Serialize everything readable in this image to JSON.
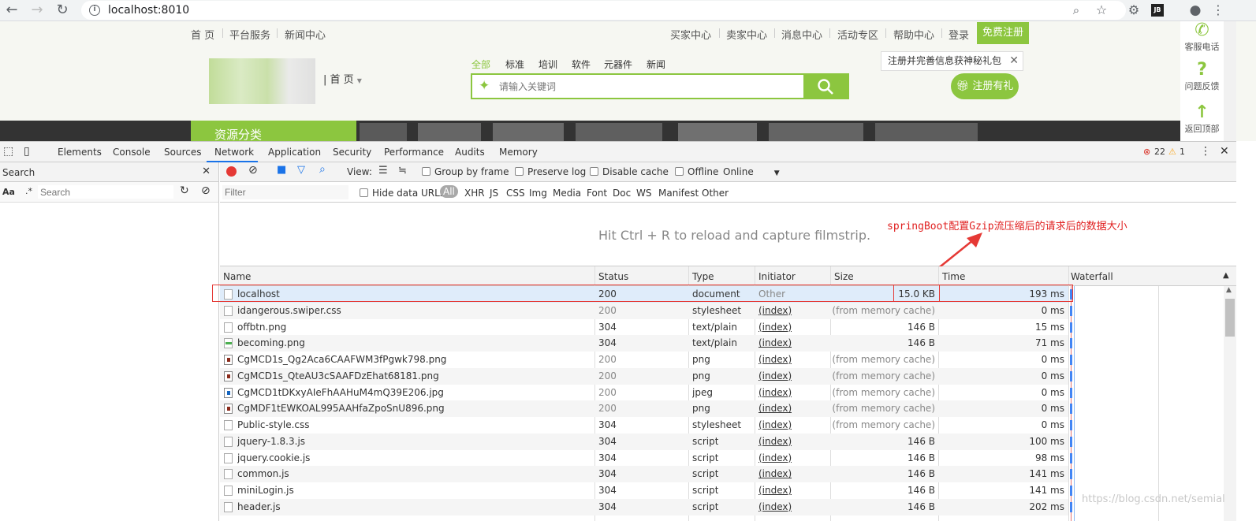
{
  "browser": {
    "url": "localhost:8010"
  },
  "site": {
    "topnav_left": [
      "首 页",
      "平台服务",
      "新闻中心"
    ],
    "topnav_right": [
      "买家中心",
      "卖家中心",
      "消息中心",
      "活动专区",
      "帮助中心",
      "登录"
    ],
    "register_button": "免费注册",
    "tooltip": "注册并完善信息获神秘礼包",
    "home_link": "| 首 页",
    "categories": [
      "全部",
      "标准",
      "培训",
      "软件",
      "元器件",
      "新闻"
    ],
    "search_placeholder": "请输入关键词",
    "gift_button": "注册有礼",
    "resource_tab": "资源分类",
    "sidebar": [
      "客服电话",
      "问题反馈",
      "返回顶部"
    ]
  },
  "devtools": {
    "tabs": [
      "Elements",
      "Console",
      "Sources",
      "Network",
      "Application",
      "Security",
      "Performance",
      "Audits",
      "Memory"
    ],
    "errors": "22",
    "warnings": "1",
    "search_title": "Search",
    "search_case": "Aa",
    "search_regex": ".*",
    "search_placeholder": "Search",
    "toolbar": {
      "view_label": "View:",
      "group_by_frame": "Group by frame",
      "preserve_log": "Preserve log",
      "disable_cache": "Disable cache",
      "offline": "Offline",
      "online": "Online"
    },
    "filter": {
      "placeholder": "Filter",
      "hide_data_urls": "Hide data URLs",
      "types": [
        "All",
        "XHR",
        "JS",
        "CSS",
        "Img",
        "Media",
        "Font",
        "Doc",
        "WS",
        "Manifest",
        "Other"
      ]
    },
    "filmstrip_message": "Hit Ctrl + R to reload and capture filmstrip.",
    "annotation": "springBoot配置Gzip流压缩后的请求后的数据大小",
    "columns": [
      "Name",
      "Status",
      "Type",
      "Initiator",
      "Size",
      "Time",
      "Waterfall"
    ],
    "rows": [
      {
        "name": "localhost",
        "status": "200",
        "type": "document",
        "initiator": "Other",
        "size": "15.0 KB",
        "time": "193 ms"
      },
      {
        "name": "idangerous.swiper.css",
        "status": "200",
        "type": "stylesheet",
        "initiator": "(index)",
        "size": "(from memory cache)",
        "time": "0 ms"
      },
      {
        "name": "offbtn.png",
        "status": "304",
        "type": "text/plain",
        "initiator": "(index)",
        "size": "146 B",
        "time": "15 ms"
      },
      {
        "name": "becoming.png",
        "status": "304",
        "type": "text/plain",
        "initiator": "(index)",
        "size": "146 B",
        "time": "71 ms"
      },
      {
        "name": "CgMCD1s_Qg2Aca6CAAFWM3fPgwk798.png",
        "status": "200",
        "type": "png",
        "initiator": "(index)",
        "size": "(from memory cache)",
        "time": "0 ms"
      },
      {
        "name": "CgMCD1s_QteAU3cSAAFDzEhat68181.png",
        "status": "200",
        "type": "png",
        "initiator": "(index)",
        "size": "(from memory cache)",
        "time": "0 ms"
      },
      {
        "name": "CgMCD1tDKxyAIeFhAAHuM4mQ39E206.jpg",
        "status": "200",
        "type": "jpeg",
        "initiator": "(index)",
        "size": "(from memory cache)",
        "time": "0 ms"
      },
      {
        "name": "CgMDF1tEWKOAL995AAHfaZpoSnU896.png",
        "status": "200",
        "type": "png",
        "initiator": "(index)",
        "size": "(from memory cache)",
        "time": "0 ms"
      },
      {
        "name": "Public-style.css",
        "status": "304",
        "type": "stylesheet",
        "initiator": "(index)",
        "size": "(from memory cache)",
        "time": "0 ms"
      },
      {
        "name": "jquery-1.8.3.js",
        "status": "304",
        "type": "script",
        "initiator": "(index)",
        "size": "146 B",
        "time": "100 ms"
      },
      {
        "name": "jquery.cookie.js",
        "status": "304",
        "type": "script",
        "initiator": "(index)",
        "size": "146 B",
        "time": "98 ms"
      },
      {
        "name": "common.js",
        "status": "304",
        "type": "script",
        "initiator": "(index)",
        "size": "146 B",
        "time": "141 ms"
      },
      {
        "name": "miniLogin.js",
        "status": "304",
        "type": "script",
        "initiator": "(index)",
        "size": "146 B",
        "time": "141 ms"
      },
      {
        "name": "header.js",
        "status": "304",
        "type": "script",
        "initiator": "(index)",
        "size": "146 B",
        "time": "202 ms"
      }
    ],
    "watermark": "https://blog.csdn.net/semial"
  }
}
